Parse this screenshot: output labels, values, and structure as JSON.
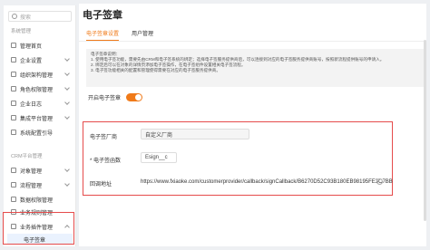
{
  "sidebar": {
    "search_placeholder": "搜索",
    "groups": [
      "系统管理",
      "CRM平台管理"
    ],
    "items": [
      {
        "label": "管理首页"
      },
      {
        "label": "企业设置"
      },
      {
        "label": "组织架构管理"
      },
      {
        "label": "角色权限管理"
      },
      {
        "label": "企业日志"
      },
      {
        "label": "集成平台管理"
      },
      {
        "label": "系统配置引导"
      },
      {
        "label": "对象管理"
      },
      {
        "label": "流程管理"
      },
      {
        "label": "数据权限管理"
      },
      {
        "label": "业务规则管理"
      },
      {
        "label": "业务插件管理"
      }
    ],
    "active_sub": "电子签章"
  },
  "main": {
    "title": "电子签章",
    "tabs": [
      {
        "label": "电子签章设置"
      },
      {
        "label": "用户管理"
      }
    ],
    "notes": [
      "电子签章说明：",
      "1. 使用电子签功能，需要先由CRM和电子签系统的绑定；选择电子签服务提供商后，可以连接到对应的电子签服务提供商账号，按照新流程提供账号的申请入。",
      "2. 绑定后可以在对象的详情页添加电子签操作，在电子签组件设置相关电子签流程。",
      "3. 电子签功能相关的配置和管理使得需要在对应的电子签服务提供商。"
    ],
    "toggle_label": "开启电子签章",
    "form": {
      "vendor_label": "电子签厂商",
      "vendor_value": "自定义厂商",
      "id_label": "* 电子签函数",
      "id_value": "Esign__c",
      "callback_label": "回调地址",
      "callback_value": "https://www.fxiaoke.com/customerprovider/callback/signCallback/B6270D52C93B180EB98195FE3C7BB"
    },
    "colors": {
      "accent": "#f07a19",
      "highlight": "#e54b4b"
    }
  }
}
